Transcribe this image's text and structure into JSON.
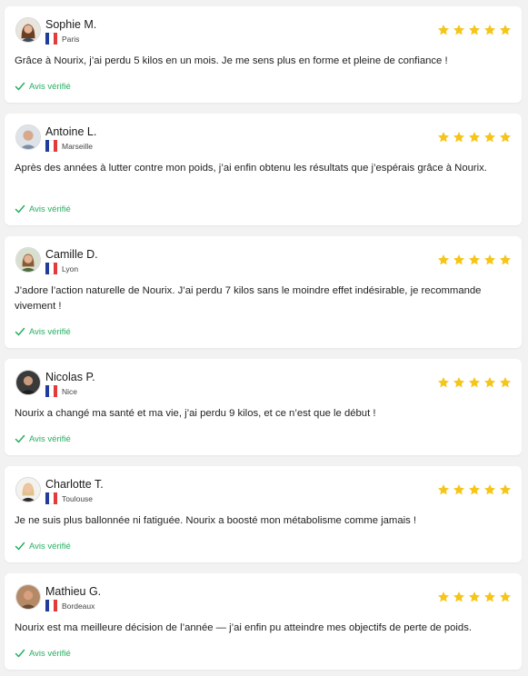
{
  "reviews": [
    {
      "name": "Sophie M.",
      "city": "Paris",
      "rating": 5,
      "text": "Grâce à Nourix, j’ai perdu 5 kilos en un mois. Je me sens plus en forme et pleine de confiance !",
      "verified_label": "Avis vérifié"
    },
    {
      "name": "Antoine L.",
      "city": "Marseille",
      "rating": 5,
      "text": "Après des années à lutter contre mon poids, j’ai enfin obtenu les résultats que j’espérais grâce à Nourix.",
      "verified_label": "Avis vérifié"
    },
    {
      "name": "Camille D.",
      "city": "Lyon",
      "rating": 5,
      "text": "J’adore l’action naturelle de Nourix. J’ai perdu 7 kilos sans le moindre effet indésirable, je recommande vivement !",
      "verified_label": "Avis vérifié"
    },
    {
      "name": "Nicolas P.",
      "city": "Nice",
      "rating": 5,
      "text": "Nourix a changé ma santé et ma vie, j’ai perdu 9 kilos, et ce n’est que le début !",
      "verified_label": "Avis vérifié"
    },
    {
      "name": "Charlotte T.",
      "city": "Toulouse",
      "rating": 5,
      "text": "Je ne suis plus ballonnée ni fatiguée. Nourix a boosté mon métabolisme comme jamais !",
      "verified_label": "Avis vérifié"
    },
    {
      "name": "Mathieu G.",
      "city": "Bordeaux",
      "rating": 5,
      "text": "Nourix est ma meilleure décision de l’année — j’ai enfin pu atteindre mes objectifs de perte de poids.",
      "verified_label": "Avis vérifié"
    }
  ],
  "colors": {
    "star": "#f5c518",
    "verified": "#27ae60",
    "flag_blue": "#1f3c9a",
    "flag_white": "#ffffff",
    "flag_red": "#e23b3b"
  },
  "icons": {
    "star": "star-icon",
    "check": "check-icon",
    "flag": "france-flag-icon"
  }
}
